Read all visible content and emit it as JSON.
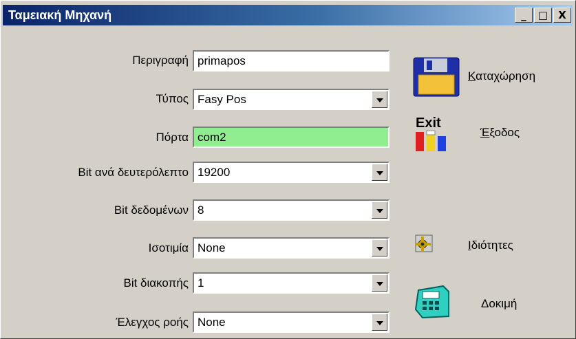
{
  "window": {
    "title": "Ταμειακή Μηχανή",
    "buttons": {
      "minimize": "_",
      "maximize": "□",
      "close": "X"
    }
  },
  "form": {
    "description": {
      "label": "Περιγραφή",
      "value": "primapos"
    },
    "type": {
      "label": "Τύπος",
      "value": "Fasy Pos"
    },
    "port": {
      "label": "Πόρτα",
      "value": "com2",
      "bg_color": "#90ee90"
    },
    "baud": {
      "label": "Bit ανά δευτερόλεπτο",
      "value": "19200"
    },
    "databits": {
      "label": "Bit δεδομένων",
      "value": "8"
    },
    "parity": {
      "label": "Ισοτιμία",
      "value": "None"
    },
    "stopbits": {
      "label": "Bit διακοπής",
      "value": "1"
    },
    "flow": {
      "label": "Έλεγχος ροής",
      "value": "None"
    }
  },
  "actions": {
    "save": {
      "first": "Κ",
      "rest": "αταχώρηση",
      "icon": "floppy-disk-icon"
    },
    "exit": {
      "first": "Έ",
      "rest": "ξοδος",
      "icon": "exit-icon",
      "icon_text": "Exit"
    },
    "properties": {
      "first": "Ι",
      "rest": "διότητες",
      "icon": "properties-icon"
    },
    "test": {
      "label": "Δοκιμή",
      "icon": "cash-register-icon"
    }
  }
}
